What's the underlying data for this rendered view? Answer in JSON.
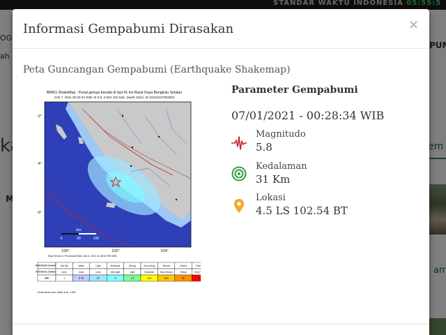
{
  "background": {
    "topbar_label": "STANDAR WAKTU INDONESIA",
    "topbar_time": "05:55:5",
    "left_text_1": "OGI,",
    "left_text_2": "ah",
    "left_text_3": "ka",
    "left_text_4": "M",
    "right_text_1": "PUM",
    "right_text_2": "em",
    "right_text_3": "ama"
  },
  "modal": {
    "title": "Informasi Gempabumi Dirasakan",
    "close_label": "×",
    "subtitle": "Peta Guncangan Gempabumi (Earthquake Shakemap)"
  },
  "shakemap": {
    "header_line_1": "BMKG ShakeMap : Pusat gempa berada di laut 41 km Barat Daya Bengkulu Selatan",
    "header_line_2": "JAN 7, 2021 00:28:34 WIB, M 5.8, 4.50S 102.54E, Depth 31km, ID 20210107002834",
    "y_ticks": [
      "-2°",
      "-4°",
      "-6°"
    ],
    "x_ticks": [
      "100°",
      "102°",
      "104°"
    ],
    "scale_label": "km",
    "scale_ticks": [
      "0",
      "50",
      "100"
    ],
    "footer_note": "Map Version 1 Processed Wed Jan 6, 2021 11:40:00 PM WIB",
    "legend": {
      "row_headers": [
        "PERCEIVED SHAKING",
        "POTENTIAL DAMAGE",
        "MMI"
      ],
      "perceived": [
        "Not felt",
        "Weak",
        "Light",
        "Moderate",
        "Strong",
        "Very strong",
        "Severe",
        "Violent",
        "Extreme"
      ],
      "damage": [
        "none",
        "none",
        "none",
        "Very light",
        "Light",
        "Moderate",
        "Mod./Heavy",
        "Heavy",
        "Very Heavy"
      ],
      "mmi": [
        "I",
        "II-III",
        "IV",
        "V",
        "VI",
        "VII",
        "VIII",
        "IX",
        "X+"
      ],
      "colors": [
        "#ffffff",
        "#bfccff",
        "#a0e6ff",
        "#80ffff",
        "#7aff93",
        "#ffff00",
        "#ffc800",
        "#ff9100",
        "#ff0000"
      ]
    },
    "legend_note": "Scale based upon Wald, et al.; 1999"
  },
  "params": {
    "title": "Parameter Gempabumi",
    "datetime": "07/01/2021 - 00:28:34 WIB",
    "items": [
      {
        "icon": "seismograph-icon",
        "label": "Magnitudo",
        "value": "5.8",
        "color": "#c62828"
      },
      {
        "icon": "depth-icon",
        "label": "Kedalaman",
        "value": "31 Km",
        "color": "#2e9e3a"
      },
      {
        "icon": "location-pin-icon",
        "label": "Lokasi",
        "value": "4.5 LS 102.54 BT",
        "color": "#f5a623"
      }
    ]
  }
}
